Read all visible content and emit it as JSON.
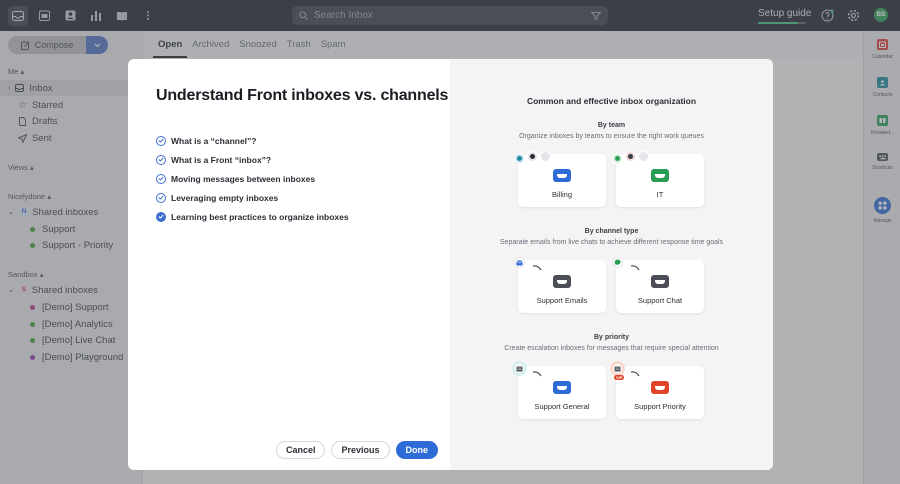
{
  "topbar": {
    "search_placeholder": "Search Inbox",
    "setup_guide": "Setup guide",
    "setup_progress": 0.83,
    "avatar_initials": "BB"
  },
  "sidebar": {
    "compose_label": "Compose",
    "section_me": "Me",
    "me_items": [
      {
        "label": "Inbox",
        "icon": "inbox-icon"
      },
      {
        "label": "Starred",
        "icon": "star-icon"
      },
      {
        "label": "Drafts",
        "icon": "draft-icon"
      },
      {
        "label": "Sent",
        "icon": "send-icon"
      }
    ],
    "section_views": "Views",
    "section_nicelydone": "Nicelydone",
    "nicelydone_shared": "Shared inboxes",
    "nicelydone_badge": "N",
    "nicelydone_inboxes": [
      {
        "label": "Support",
        "color": "#3a9a3f"
      },
      {
        "label": "Support - Priority",
        "color": "#3a9a3f"
      }
    ],
    "section_sandbox": "Sandbox",
    "sandbox_shared": "Shared inboxes",
    "sandbox_badge": "S",
    "sandbox_inboxes": [
      {
        "label": "[Demo] Support",
        "color": "#b03a8c"
      },
      {
        "label": "[Demo] Analytics",
        "color": "#3a9a3f"
      },
      {
        "label": "[Demo] Live Chat",
        "color": "#3a9a3f"
      },
      {
        "label": "[Demo] Playground",
        "color": "#8a3ab0"
      }
    ]
  },
  "tabs": [
    "Open",
    "Archived",
    "Snoozed",
    "Trash",
    "Spam"
  ],
  "rail": [
    {
      "label": "Calendar",
      "color": "#d93b3b"
    },
    {
      "label": "Contacts",
      "color": "#1f8a9c"
    },
    {
      "label": "Knowled...",
      "color": "#2a9d54"
    },
    {
      "label": "Shortcuts",
      "color": "#4b4e57"
    },
    {
      "label": "Manage",
      "color": "#2f6bd6"
    }
  ],
  "modal": {
    "title": "Understand Front inboxes vs. channels",
    "questions": [
      {
        "label": "What is a “channel”?",
        "done": false
      },
      {
        "label": "What is a Front “inbox”?",
        "done": false
      },
      {
        "label": "Moving messages between inboxes",
        "done": false
      },
      {
        "label": "Leveraging empty inboxes",
        "done": false
      },
      {
        "label": "Learning best practices to organize inboxes",
        "done": true
      }
    ],
    "buttons": {
      "cancel": "Cancel",
      "previous": "Previous",
      "done": "Done"
    },
    "right_heading": "Common and effective inbox organization",
    "groups": [
      {
        "title": "By team",
        "desc": "Organize inboxes by teams to ensure the right work queues",
        "cards": [
          {
            "label": "Billing",
            "color": "#2f6bd6"
          },
          {
            "label": "IT",
            "color": "#2a9d54"
          }
        ]
      },
      {
        "title": "By channel type",
        "desc": "Separate emails from live chats to achieve different response time goals",
        "cards": [
          {
            "label": "Support Emails",
            "color": "#4b4e57"
          },
          {
            "label": "Support Chat",
            "color": "#4b4e57"
          }
        ]
      },
      {
        "title": "By priority",
        "desc": "Create escalation inboxes for messages that require special attention",
        "cards": [
          {
            "label": "Support General",
            "color": "#2f6bd6"
          },
          {
            "label": "Support Priority",
            "color": "#e0452b"
          }
        ]
      }
    ],
    "vip_badge": "VIP"
  }
}
